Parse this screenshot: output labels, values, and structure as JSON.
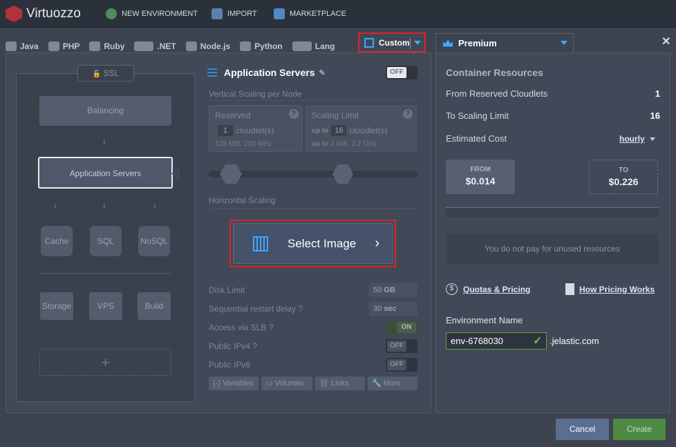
{
  "app": {
    "name": "Virtuozzo",
    "new_env": "NEW ENVIRONMENT",
    "import": "IMPORT",
    "marketplace": "MARKETPLACE"
  },
  "tabs": [
    "Java",
    "PHP",
    "Ruby",
    ".NET",
    "Node.js",
    "Python",
    "Lang"
  ],
  "custom_tab": "Custom",
  "premium_tab": "Premium",
  "topology": {
    "ssl": "SSL",
    "balancing": "Balancing",
    "app_servers": "Application Servers",
    "cache": "Cache",
    "sql": "SQL",
    "nosql": "NoSQL",
    "storage": "Storage",
    "vps": "VPS",
    "build": "Build",
    "add": "+"
  },
  "app_servers": {
    "title": "Application Servers",
    "toggle": "OFF",
    "vertical_label": "Vertical Scaling per Node",
    "reserved": {
      "title": "Reserved",
      "value": "1",
      "unit": "cloudlet(s)",
      "sub": "128 MiB, 200 MHz"
    },
    "scaling": {
      "title": "Scaling Limit",
      "prefix": "up to",
      "value": "16",
      "unit": "cloudlet(s)",
      "sub_prefix": "up to",
      "sub": "2 GiB, 3.2 GHz"
    },
    "horizontal_label": "Horizontal Scaling",
    "select_image": "Select Image",
    "disk_limit": {
      "label": "Disk Limit",
      "value": "50",
      "unit": "GB"
    },
    "restart_delay": {
      "label": "Sequential restart delay",
      "value": "30",
      "unit": "sec"
    },
    "slb": {
      "label": "Access via SLB",
      "state": "ON"
    },
    "ipv4": {
      "label": "Public IPv4",
      "state": "OFF"
    },
    "ipv6": {
      "label": "Public IPv6",
      "state": "OFF"
    },
    "buttons": [
      "Variables",
      "Volumes",
      "Links",
      "More"
    ]
  },
  "resources": {
    "title": "Container Resources",
    "reserved_label": "From Reserved Cloudlets",
    "reserved_value": "1",
    "limit_label": "To Scaling Limit",
    "limit_value": "16",
    "cost_label": "Estimated Cost",
    "cost_period": "hourly",
    "from_label": "FROM",
    "from_value": "$0.014",
    "to_label": "TO",
    "to_value": "$0.226",
    "unused": "You do not pay for unused resources",
    "quotas": "Quotas & Pricing",
    "how": "How Pricing Works",
    "env_label": "Environment Name",
    "env_value": "env-6768030",
    "domain": ".jelastic.com"
  },
  "footer": {
    "cancel": "Cancel",
    "create": "Create"
  }
}
